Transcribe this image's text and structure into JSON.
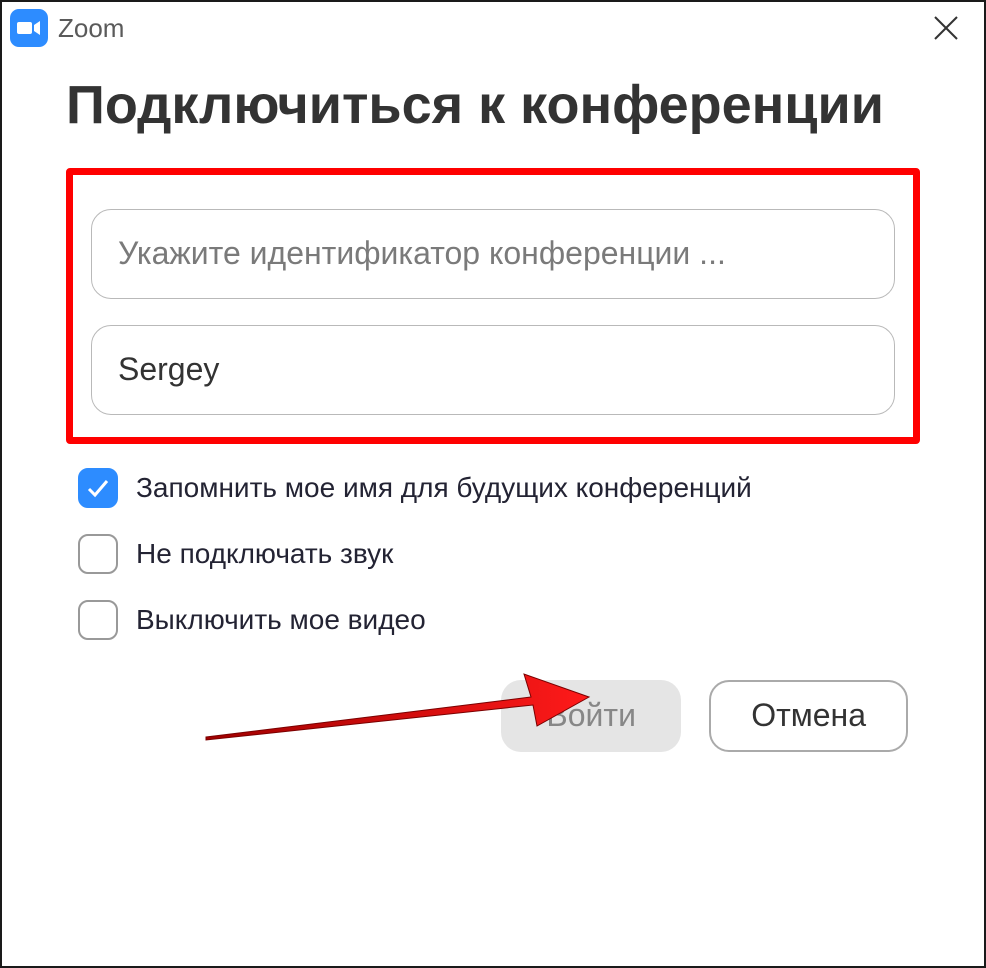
{
  "titlebar": {
    "appName": "Zoom"
  },
  "heading": "Подключиться к конференции",
  "inputs": {
    "meetingId": {
      "placeholder": "Укажите идентификатор конференции ...",
      "value": ""
    },
    "name": {
      "placeholder": "",
      "value": "Sergey"
    }
  },
  "checkboxes": {
    "rememberName": {
      "label": "Запомнить мое имя для будущих конференций",
      "checked": true
    },
    "noAudio": {
      "label": "Не подключать звук",
      "checked": false
    },
    "noVideo": {
      "label": "Выключить мое видео",
      "checked": false
    }
  },
  "buttons": {
    "join": "Войти",
    "cancel": "Отмена"
  },
  "annotations": {
    "highlightColor": "#ff0000",
    "arrowColor": "#ff0000"
  }
}
